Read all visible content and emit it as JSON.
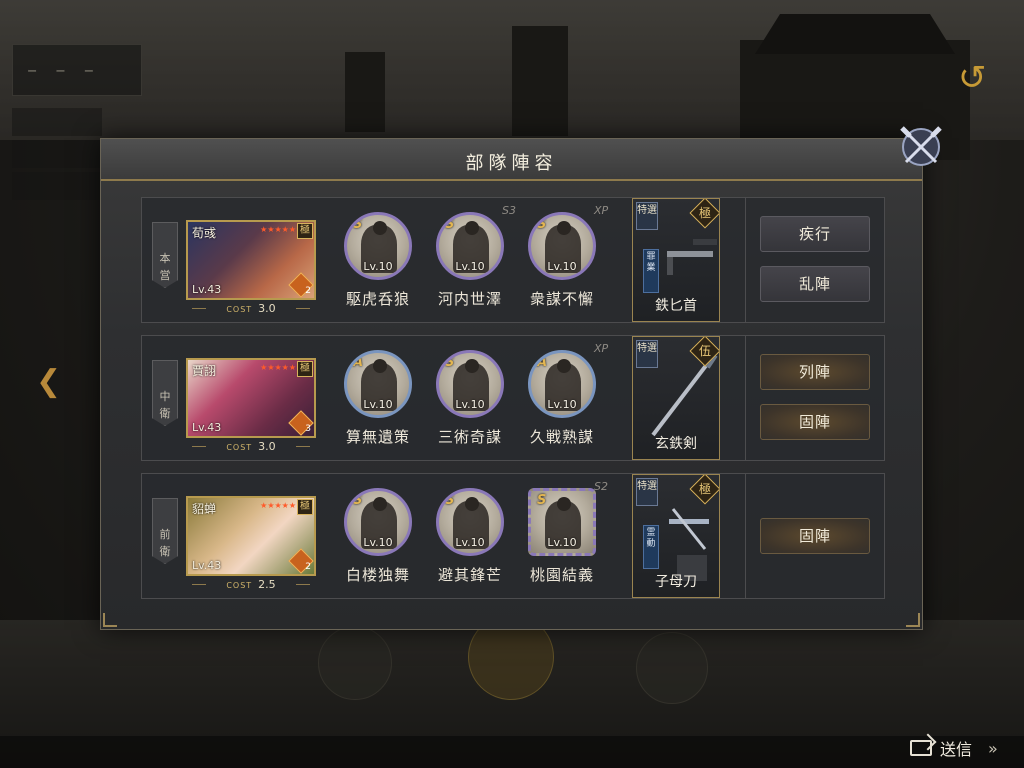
{
  "modal": {
    "title": "部隊陣容"
  },
  "send": {
    "label": "送信",
    "chevron": "»"
  },
  "rows": [
    {
      "position_label": [
        "本",
        "営"
      ],
      "hero": {
        "name": "荀彧",
        "level": "Lv.43",
        "cost_label": "COST",
        "cost": "3.0",
        "stars": "★★★★★",
        "grade": "極",
        "badge_num": "2",
        "badge_color": "#c8621e"
      },
      "skills": [
        {
          "rank": "S",
          "level": "Lv.10",
          "name": "駆虎呑狼",
          "ring": "purple"
        },
        {
          "rank": "S",
          "level": "Lv.10",
          "name": "河内世澤",
          "ring": "purple"
        },
        {
          "rank": "S",
          "level": "Lv.10",
          "name": "衆謀不懈",
          "ring": "purple"
        }
      ],
      "skill_tags": [
        "S3",
        "XP"
      ],
      "weapon": {
        "tokusen": "特選",
        "grade": "極",
        "tassel": "罪業",
        "name": "鉄匕首"
      },
      "actions": [
        "疾行",
        "乱陣"
      ],
      "action_style": "cool"
    },
    {
      "position_label": [
        "中",
        "衛"
      ],
      "hero": {
        "name": "賈詡",
        "level": "Lv.43",
        "cost_label": "COST",
        "cost": "3.0",
        "stars": "★★★★★",
        "grade": "極",
        "badge_num": "3",
        "badge_color": "#c8621e"
      },
      "skills": [
        {
          "rank": "A",
          "level": "Lv.10",
          "name": "算無遺策",
          "ring": "blue"
        },
        {
          "rank": "S",
          "level": "Lv.10",
          "name": "三術奇謀",
          "ring": "purple"
        },
        {
          "rank": "A",
          "level": "Lv.10",
          "name": "久戦熟謀",
          "ring": "blue"
        }
      ],
      "skill_tags": [
        "XP"
      ],
      "weapon": {
        "tokusen": "特選",
        "grade": "伍",
        "tassel": "",
        "name": "玄鉄剣"
      },
      "actions": [
        "列陣",
        "固陣"
      ],
      "action_style": "warm"
    },
    {
      "position_label": [
        "前",
        "衛"
      ],
      "hero": {
        "name": "貂蝉",
        "level": "Lv.43",
        "cost_label": "COST",
        "cost": "2.5",
        "stars": "★★★★★",
        "grade": "極",
        "badge_num": "2",
        "badge_color": "#c8621e"
      },
      "skills": [
        {
          "rank": "S",
          "level": "Lv.10",
          "name": "白楼独舞",
          "ring": "purple"
        },
        {
          "rank": "S",
          "level": "Lv.10",
          "name": "避其鋒芒",
          "ring": "purple"
        },
        {
          "rank": "S",
          "level": "Lv.10",
          "name": "桃園結義",
          "ring": "square"
        }
      ],
      "skill_tags": [
        "S2"
      ],
      "weapon": {
        "tokusen": "特選",
        "grade": "極",
        "tassel": "霊動",
        "name": "子母刀"
      },
      "actions": [
        "固陣"
      ],
      "action_style": "warm"
    }
  ]
}
